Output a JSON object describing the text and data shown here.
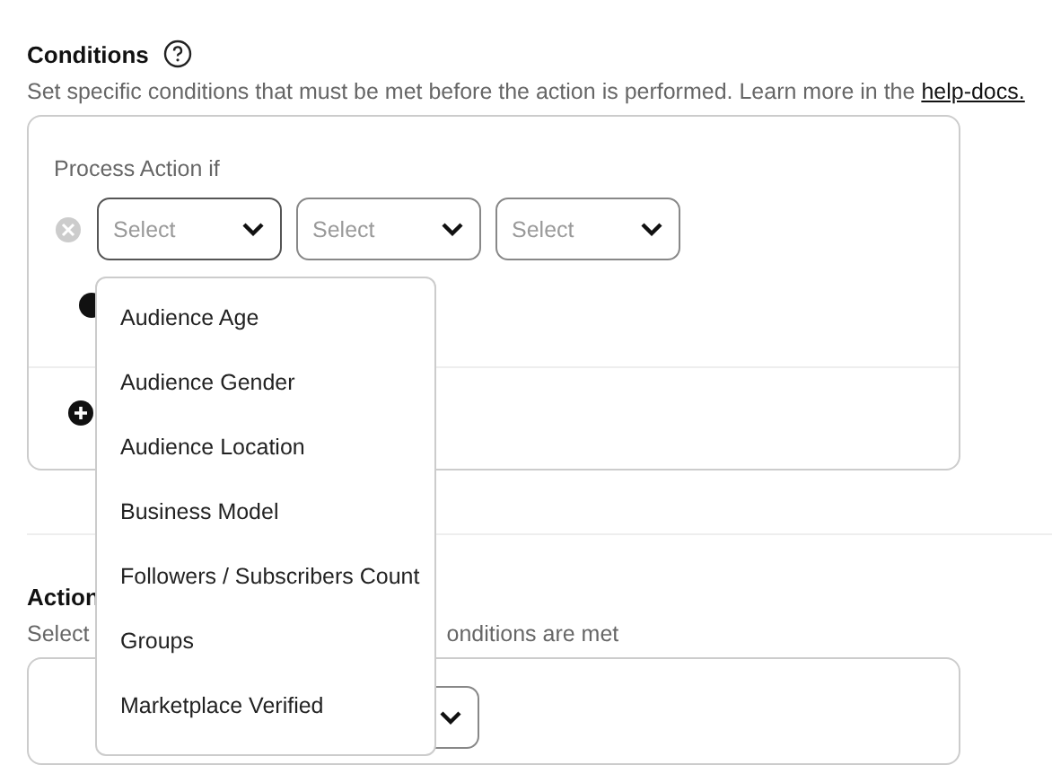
{
  "conditions": {
    "title": "Conditions",
    "description": "Set specific conditions that must be met before the action is performed. Learn more in the ",
    "link": "help-docs.",
    "rule_label": "Process Action if",
    "selects": [
      {
        "placeholder": "Select",
        "open": true
      },
      {
        "placeholder": "Select",
        "open": false
      },
      {
        "placeholder": "Select",
        "open": false
      }
    ],
    "menu": [
      {
        "label": "Audience Age"
      },
      {
        "label": "Audience Gender"
      },
      {
        "label": "Audience Location"
      },
      {
        "label": "Business Model"
      },
      {
        "label": "Followers / Subscribers Count"
      },
      {
        "label": "Groups"
      },
      {
        "label": "Marketplace Verified"
      }
    ]
  },
  "actions": {
    "title": "Action",
    "description_start": "Select",
    "description_end": "onditions are met"
  }
}
